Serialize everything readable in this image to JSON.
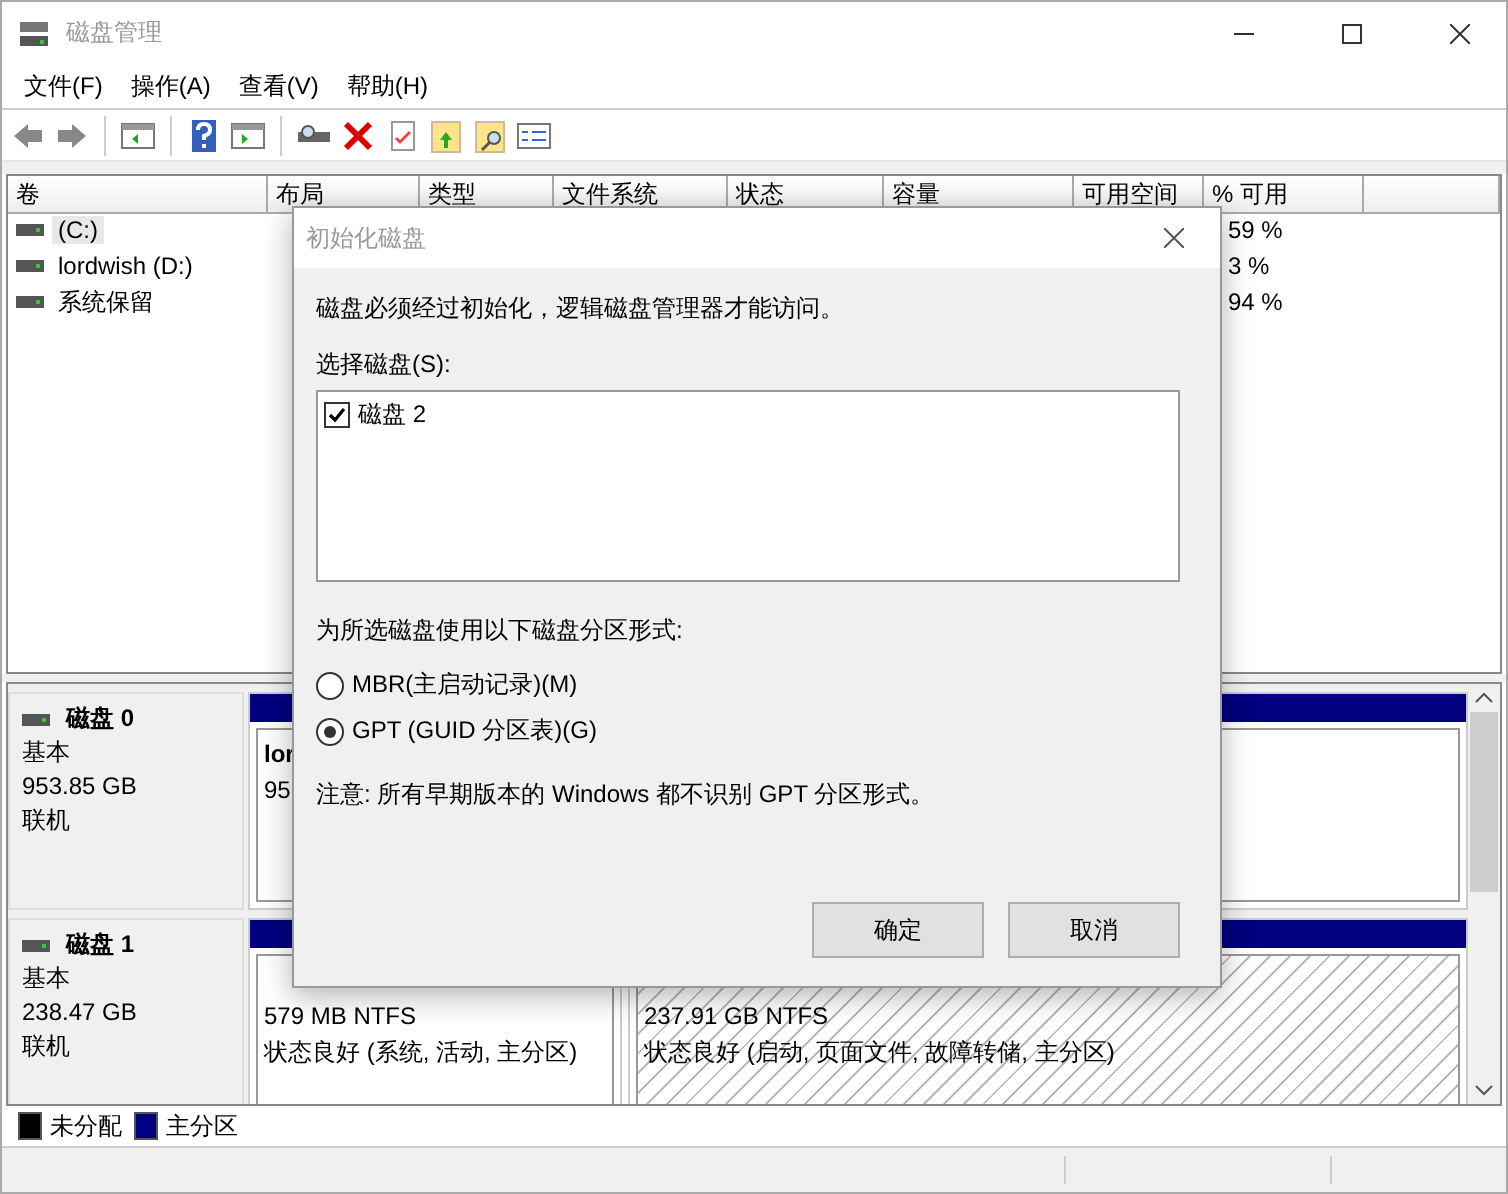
{
  "window": {
    "title": "磁盘管理"
  },
  "menu": [
    {
      "label": "文件(F)"
    },
    {
      "label": "操作(A)"
    },
    {
      "label": "查看(V)"
    },
    {
      "label": "帮助(H)"
    }
  ],
  "volume_table": {
    "columns": [
      "卷",
      "布局",
      "类型",
      "文件系统",
      "状态",
      "容量",
      "可用空间",
      "% 可用"
    ],
    "rows": [
      {
        "volume": "(C:)",
        "percent_free": "59 %",
        "selected": true
      },
      {
        "volume": "lordwish (D:)",
        "percent_free": "3 %",
        "selected": false
      },
      {
        "volume": "系统保留",
        "percent_free": "94 %",
        "selected": false
      }
    ]
  },
  "disks": [
    {
      "name": "磁盘 0",
      "type": "基本",
      "size": "953.85 GB",
      "status": "联机",
      "partitions": [
        {
          "title": "lor",
          "lines": [
            "95"
          ],
          "selected": false
        }
      ]
    },
    {
      "name": "磁盘 1",
      "type": "基本",
      "size": "238.47 GB",
      "status": "联机",
      "partitions": [
        {
          "lines": [
            "579 MB NTFS",
            "状态良好 (系统, 活动, 主分区)"
          ],
          "selected": false
        },
        {
          "lines": [
            "237.91 GB NTFS",
            "状态良好 (启动, 页面文件, 故障转储, 主分区)"
          ],
          "selected": true
        }
      ]
    }
  ],
  "legend": [
    {
      "label": "未分配",
      "color": "#000000"
    },
    {
      "label": "主分区",
      "color": "#000080"
    }
  ],
  "dialog": {
    "title": "初始化磁盘",
    "message": "磁盘必须经过初始化，逻辑磁盘管理器才能访问。",
    "disk_list_label": "选择磁盘(S):",
    "disks": [
      {
        "label": "磁盘 2",
        "checked": true
      }
    ],
    "style_label": "为所选磁盘使用以下磁盘分区形式:",
    "styles": [
      {
        "label": "MBR(主启动记录)(M)",
        "selected": false
      },
      {
        "label": "GPT (GUID 分区表)(G)",
        "selected": true
      }
    ],
    "note": "注意: 所有早期版本的 Windows 都不识别 GPT 分区形式。",
    "buttons": [
      {
        "label": "确定"
      },
      {
        "label": "取消"
      }
    ]
  }
}
